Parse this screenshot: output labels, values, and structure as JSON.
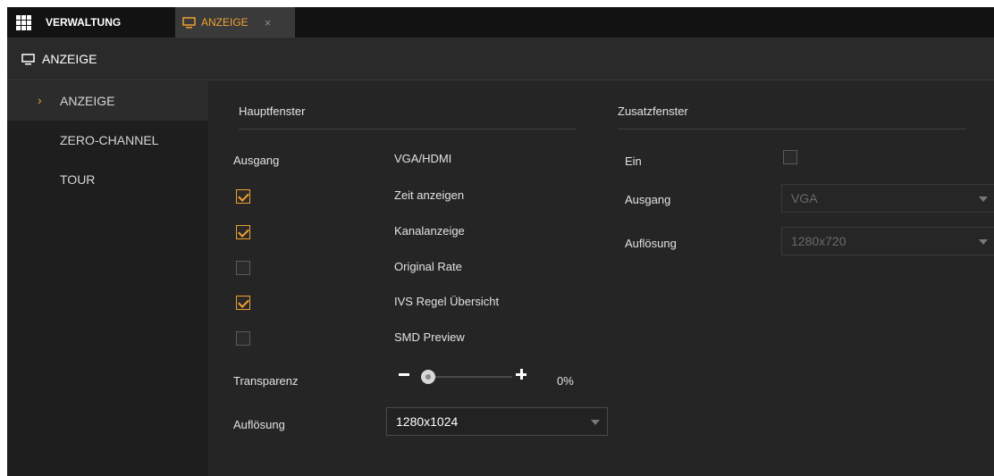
{
  "tabbar": {
    "home_label": "VERWALTUNG",
    "active_tab_label": "ANZEIGE",
    "close_glyph": "×"
  },
  "title": "ANZEIGE",
  "sidebar": {
    "items": [
      {
        "label": "ANZEIGE",
        "active": true
      },
      {
        "label": "ZERO-CHANNEL",
        "active": false
      },
      {
        "label": "TOUR",
        "active": false
      }
    ]
  },
  "haupt": {
    "heading": "Hauptfenster",
    "ausgang_label": "Ausgang",
    "ausgang_value": "VGA/HDMI",
    "options": [
      {
        "label": "Zeit anzeigen",
        "checked": true
      },
      {
        "label": "Kanalanzeige",
        "checked": true
      },
      {
        "label": "Original Rate",
        "checked": false
      },
      {
        "label": "IVS Regel Übersicht",
        "checked": true
      },
      {
        "label": "SMD Preview",
        "checked": false
      }
    ],
    "transparenz_label": "Transparenz",
    "transparenz_value": "0%",
    "aufloesung_label": "Auflösung",
    "aufloesung_value": "1280x1024"
  },
  "zusatz": {
    "heading": "Zusatzfenster",
    "ein_label": "Ein",
    "ein_checked": false,
    "ausgang_label": "Ausgang",
    "ausgang_value": "VGA",
    "aufloesung_label": "Auflösung",
    "aufloesung_value": "1280x720"
  },
  "colors": {
    "accent": "#f0a030",
    "background": "#252525",
    "sidebar": "#1e1e1e"
  }
}
